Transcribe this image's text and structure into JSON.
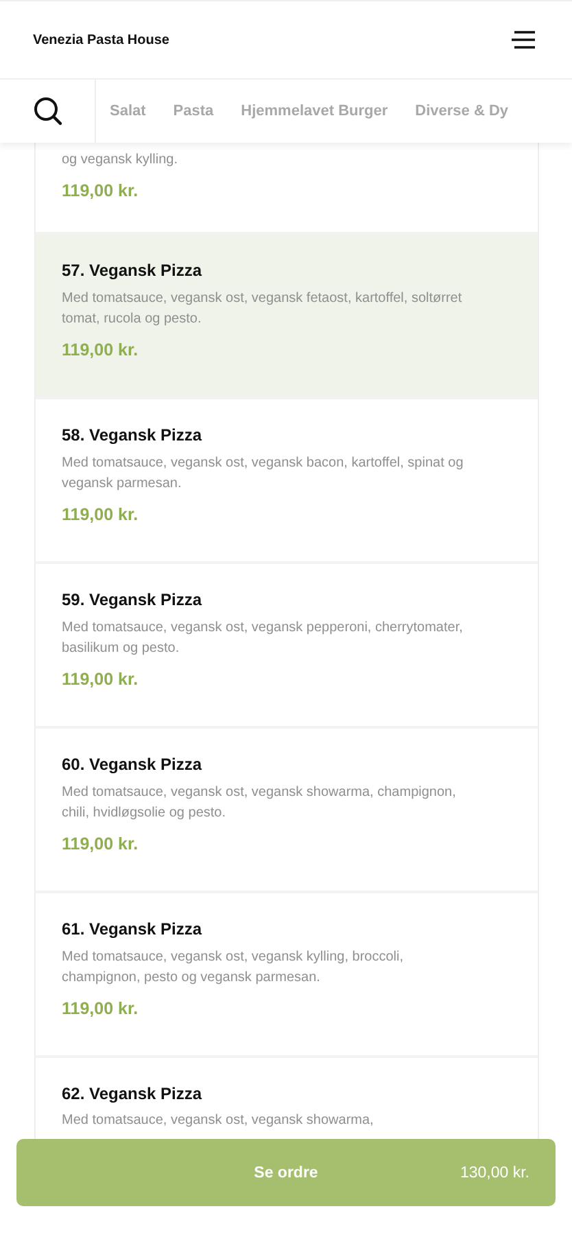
{
  "header": {
    "title": "Venezia Pasta House"
  },
  "categories": [
    {
      "label": "Salat",
      "selected": false
    },
    {
      "label": "Pasta",
      "selected": false
    },
    {
      "label": "Hjemmelavet Burger",
      "selected": false
    },
    {
      "label": "Diverse & Dy",
      "selected": false
    }
  ],
  "items": [
    {
      "kind": "partial",
      "description": "og vegansk kylling.",
      "price": "119,00 kr.",
      "selected": false
    },
    {
      "kind": "full",
      "title": "57. Vegansk Pizza",
      "description": "Med tomatsauce, vegansk ost, vegansk fetaost, kartoffel, soltørret tomat, rucola og pesto.",
      "price": "119,00 kr.",
      "selected": true
    },
    {
      "kind": "full",
      "title": "58. Vegansk Pizza",
      "description": "Med tomatsauce, vegansk ost, vegansk bacon, kartoffel, spinat og vegansk parmesan.",
      "price": "119,00 kr.",
      "selected": false
    },
    {
      "kind": "full",
      "title": "59. Vegansk Pizza",
      "description": "Med tomatsauce, vegansk ost, vegansk pepperoni, cherrytomater, basilikum og pesto.",
      "price": "119,00 kr.",
      "selected": false
    },
    {
      "kind": "full",
      "title": "60. Vegansk Pizza",
      "description": "Med tomatsauce, vegansk ost, vegansk showarma, champignon, chili, hvidløgsolie og pesto.",
      "price": "119,00 kr.",
      "selected": false
    },
    {
      "kind": "full",
      "title": "61. Vegansk Pizza",
      "description": "Med tomatsauce, vegansk ost, vegansk kylling, broccoli, champignon, pesto og vegansk parmesan.",
      "price": "119,00 kr.",
      "selected": false
    },
    {
      "kind": "covered",
      "title": "62. Vegansk Pizza",
      "description": "Med tomatsauce, vegansk ost, vegansk showarma,",
      "selected": false
    }
  ],
  "order_button": {
    "label": "Se ordre",
    "total": "130,00 kr."
  }
}
